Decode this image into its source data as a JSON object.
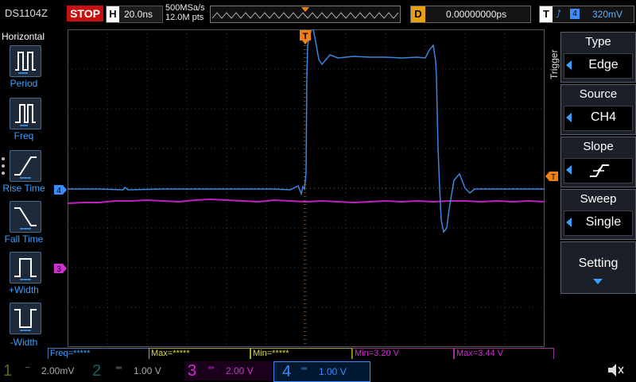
{
  "header": {
    "model": "DS1104Z",
    "status": "STOP",
    "horizontal_label": "H",
    "timebase": "20.0ns",
    "sample_rate": "500MSa/s",
    "memory_depth": "12.0M pts",
    "delay_label": "D",
    "delay_value": "0.00000000ps",
    "trigger_label": "T",
    "trigger_source_num": "4",
    "trigger_level": "320mV",
    "trigger_marker": "T"
  },
  "left_menu": {
    "title": "Horizontal",
    "items": [
      {
        "label": "Period",
        "icon": "period-icon"
      },
      {
        "label": "Freq",
        "icon": "freq-icon"
      },
      {
        "label": "Rise Time",
        "icon": "rise-time-icon"
      },
      {
        "label": "Fall Time",
        "icon": "fall-time-icon"
      },
      {
        "label": "+Width",
        "icon": "positive-width-icon"
      },
      {
        "label": "-Width",
        "icon": "negative-width-icon"
      }
    ]
  },
  "trigger_menu": {
    "title": "Trigger",
    "items": [
      {
        "title": "Type",
        "value": "Edge"
      },
      {
        "title": "Source",
        "value": "CH4"
      },
      {
        "title": "Slope",
        "value": ""
      },
      {
        "title": "Sweep",
        "value": "Single"
      }
    ],
    "setting_label": "Setting"
  },
  "channel_markers": {
    "ch4": "4",
    "ch3": "3",
    "trigger_level": "T"
  },
  "measurements": [
    {
      "text": "Freq=*****",
      "color": "#3aa0ff"
    },
    {
      "text": "Max=*****",
      "color": "#d8d840"
    },
    {
      "text": "Min=*****",
      "color": "#d8d840"
    },
    {
      "text": "Min=3.20 V",
      "color": "#d030d0"
    },
    {
      "text": "Max=3.44 V",
      "color": "#d030d0"
    }
  ],
  "channels": [
    {
      "num": "1",
      "scale": "2.00mV",
      "color": "#c8c820"
    },
    {
      "num": "2",
      "scale": "1.00 V",
      "color": "#20c8c8"
    },
    {
      "num": "3",
      "scale": "2.00 V",
      "color": "#d030d0"
    },
    {
      "num": "4",
      "scale": "1.00 V",
      "color": "#3a8cff"
    }
  ],
  "colors": {
    "ch3": "#c020c0",
    "ch4": "#3a86e0",
    "trigger": "#f08010",
    "grid": "#3a3a3a",
    "stop": "#c81010"
  }
}
